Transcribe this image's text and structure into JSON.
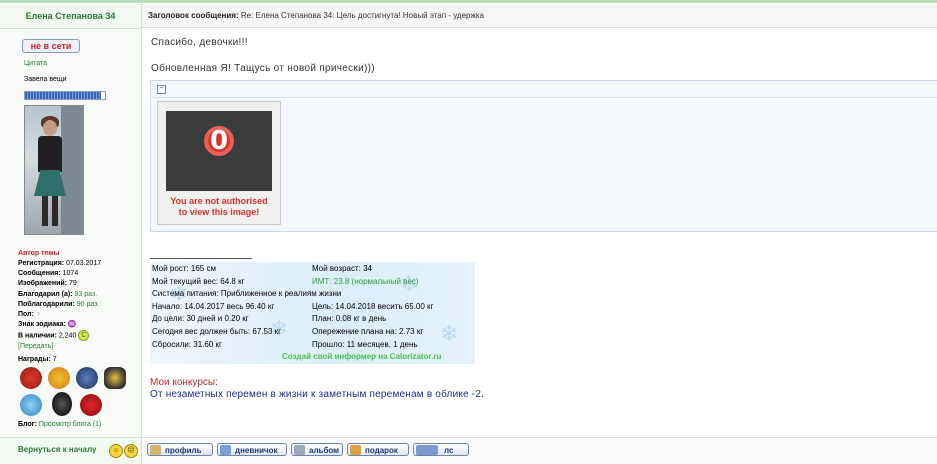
{
  "header": {
    "author_name": "Елена Степанова 34",
    "subject_label": "Заголовок сообщения:",
    "subject_text": "Re: Елена Степанова 34: Цель достигнута! Новый этап - удержка"
  },
  "sidebar": {
    "offline_badge": "не в сети",
    "quote_link": "Цитата",
    "status_text": "Завела вещи",
    "progress_fraction": 0.95,
    "author_title": "Автор темы",
    "stats": {
      "registration_label": "Регистрация:",
      "registration_value": "07.03.2017",
      "messages_label": "Сообщения:",
      "messages_value": "1074",
      "images_label": "Изображений:",
      "images_value": "79",
      "thanked_label": "Благодарил (а):",
      "thanked_value": "93 раз.",
      "got_thanks_label": "Поблагодарили:",
      "got_thanks_value": "90 раз.",
      "gender_label": "Пол:",
      "zodiac_label": "Знак зодиака:",
      "balance_label": "В наличии:",
      "balance_value": "2,240",
      "balance_badge": "C",
      "transfer_link": "[Передать]",
      "awards_label": "Награды:",
      "awards_value": "7",
      "blog_label": "Блог:",
      "blog_link": "Просмотр блога (1)"
    }
  },
  "post": {
    "line1": "Спасибо, девочки!!!",
    "line2": "Обновленная Я! Тащусь от новой прически)))",
    "spoiler_toggle": "−",
    "blocked_zero": "0",
    "blocked_line1": "You are not authorised",
    "blocked_line2": "to view this image!"
  },
  "informer": {
    "rows": [
      {
        "left": "Мой рост: 165 см",
        "right": "Мой возраст: 34"
      },
      {
        "left": "Мой текущий вес: 64.8 кг",
        "right": "ИМТ: 23.8 (нормальный вес)"
      },
      {
        "left": "Система питания: Приближенное к реалиям жизни",
        "right": ""
      },
      {
        "left": "Начало: 14.04.2017 весь 96.40 кг",
        "right": "Цель: 14.04.2018 весить 65.00 кг"
      },
      {
        "left": "До цели: 30 дней и 0.20 кг",
        "right": "План: 0.08 кг в день"
      },
      {
        "left": "Сегодня вес должен быть: 67.53 кг",
        "right": "Опережение плана на: 2.73 кг"
      },
      {
        "left": "Сбросили: 31.60 кг",
        "right": "Прошло: 11 месяцев, 1 день"
      }
    ],
    "brand": "Создай свой информер на Calorizator.ru"
  },
  "contests": {
    "title": "Мои конкурсы:",
    "link": "От незаметных перемен в жизни к заметным переменам в облике -2."
  },
  "footer": {
    "back_link": "Вернуться к началу",
    "buttons": [
      "профиль",
      "дневничок",
      "альбом",
      "подарок",
      "лс"
    ]
  },
  "colors": {
    "green_link": "#2c7a36",
    "red_title": "#c0262a",
    "button_text": "#203a76"
  }
}
